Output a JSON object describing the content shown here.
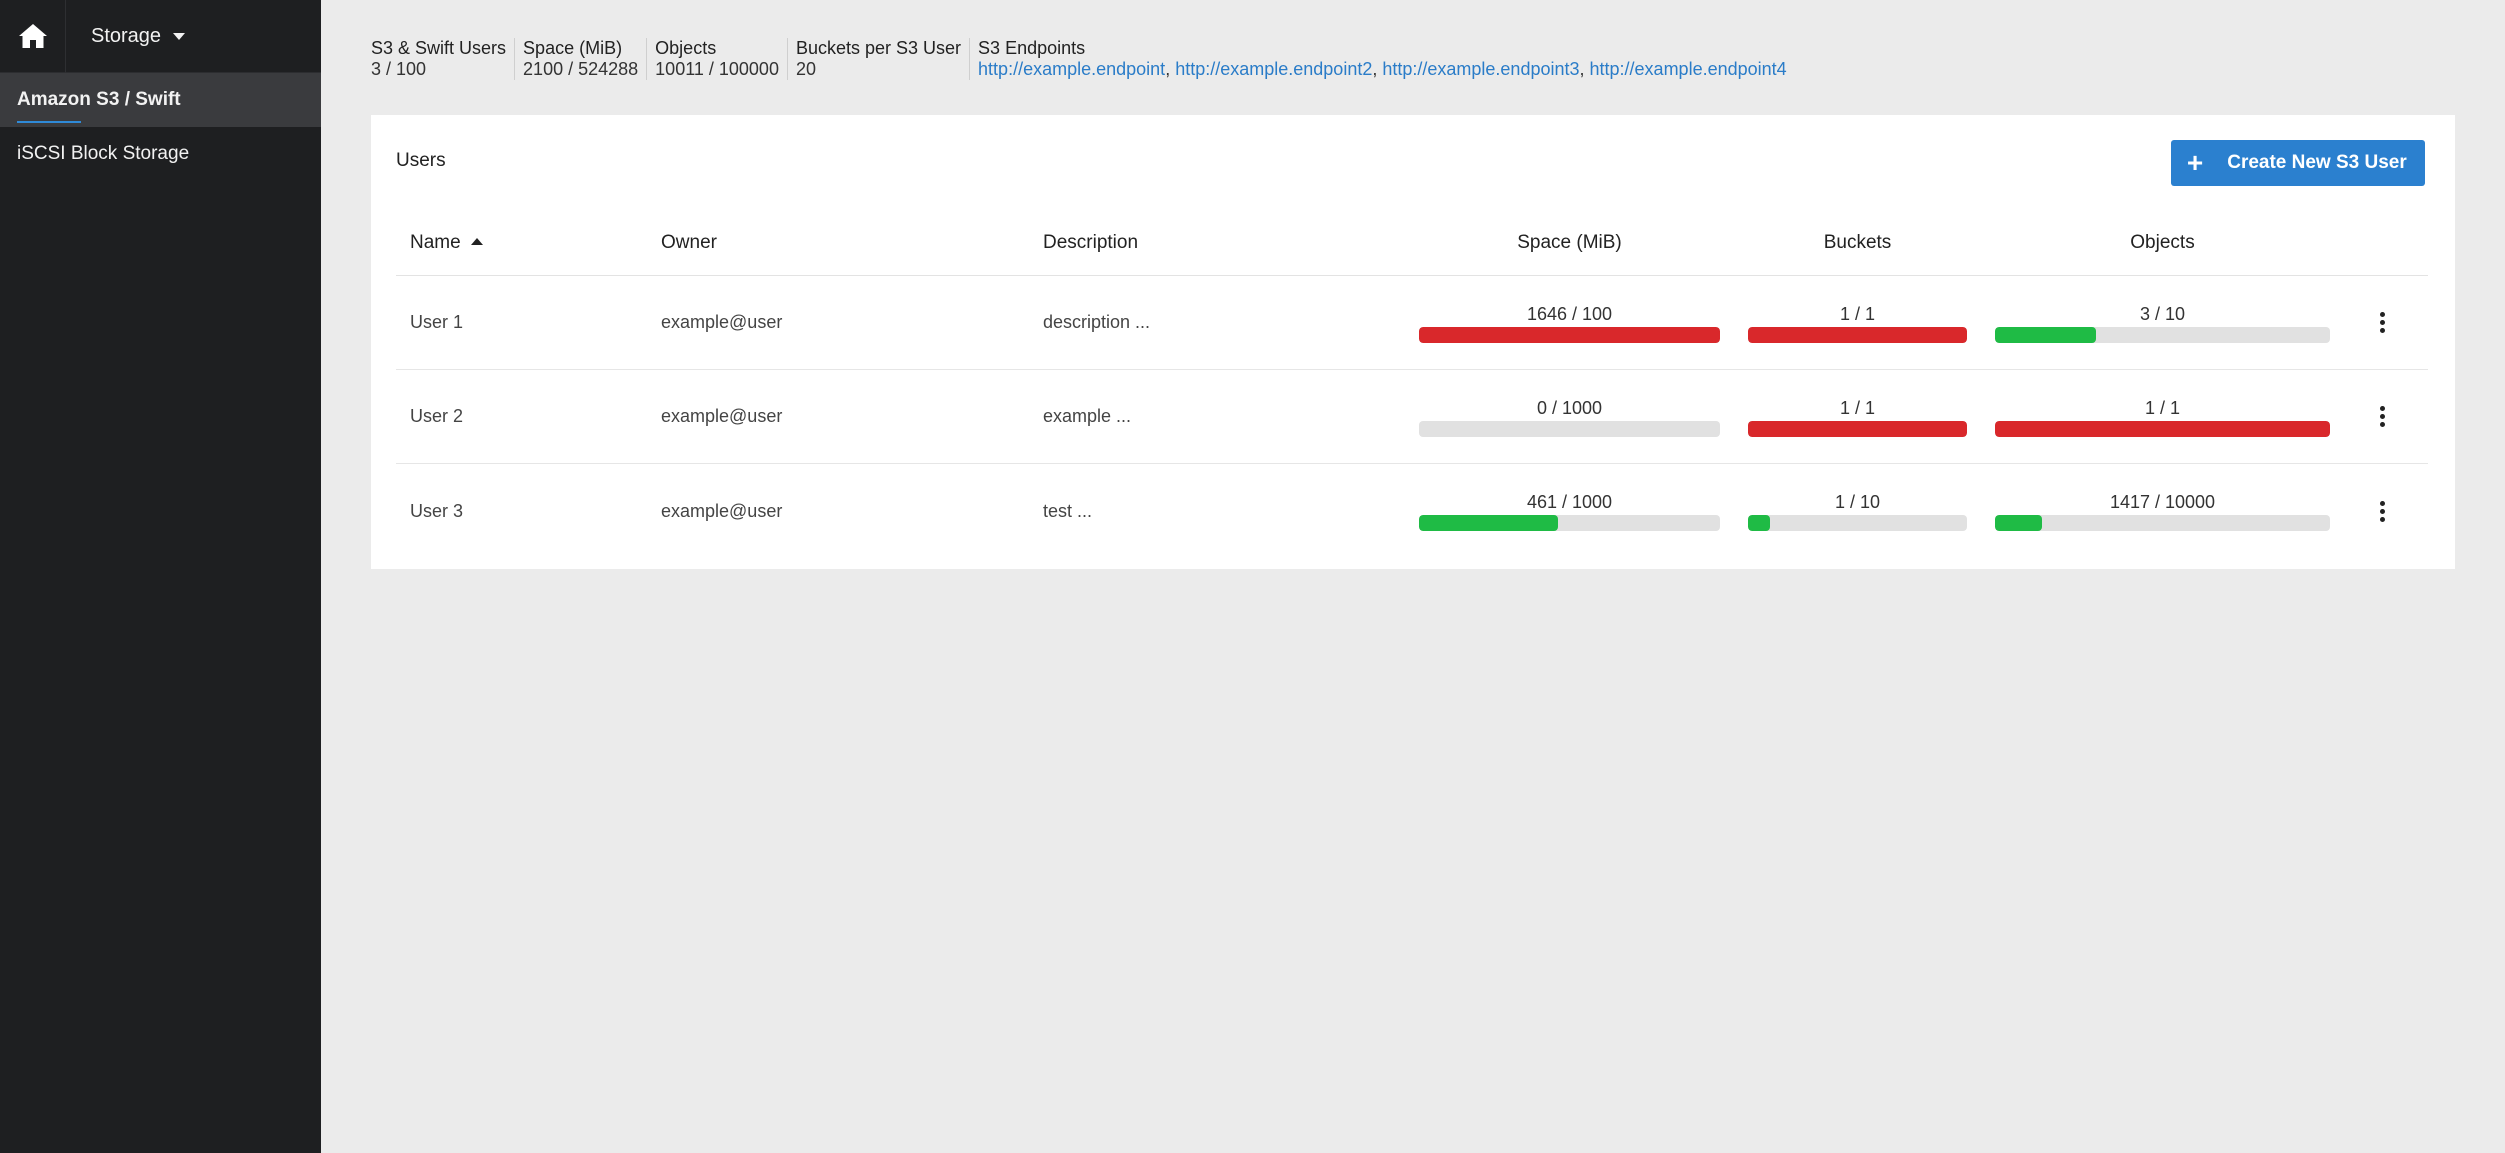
{
  "nav": {
    "home_icon": "home-icon",
    "storage_label": "Storage",
    "items": [
      {
        "label": "Amazon S3 / Swift",
        "active": true
      },
      {
        "label": "iSCSI Block Storage",
        "active": false
      }
    ]
  },
  "stats": [
    {
      "label": "S3 & Swift Users",
      "value": "3 / 100"
    },
    {
      "label": "Space (MiB)",
      "value": "2100 / 524288"
    },
    {
      "label": "Objects",
      "value": "10011 / 100000"
    },
    {
      "label": "Buckets per S3 User",
      "value": "20"
    }
  ],
  "endpoints": {
    "label": "S3 Endpoints",
    "links": [
      "http://example.endpoint",
      "http://example.endpoint2",
      "http://example.endpoint3",
      "http://example.endpoint4"
    ]
  },
  "card": {
    "title": "Users",
    "create_button": "Create New S3 User"
  },
  "table": {
    "headers": {
      "name": "Name",
      "owner": "Owner",
      "description": "Description",
      "space": "Space (MiB)",
      "buckets": "Buckets",
      "objects": "Objects"
    },
    "rows": [
      {
        "name": "User 1",
        "owner": "example@user",
        "description": "description ...",
        "space": {
          "label": "1646 / 100",
          "fraction": 1.0,
          "status": "red"
        },
        "buckets": {
          "label": "1 / 1",
          "fraction": 1.0,
          "status": "red"
        },
        "objects": {
          "label": "3 / 10",
          "fraction": 0.3,
          "status": "green"
        }
      },
      {
        "name": "User 2",
        "owner": "example@user",
        "description": "example ...",
        "space": {
          "label": "0 / 1000",
          "fraction": 0.0,
          "status": "green"
        },
        "buckets": {
          "label": "1 / 1",
          "fraction": 1.0,
          "status": "red"
        },
        "objects": {
          "label": "1 / 1",
          "fraction": 1.0,
          "status": "red"
        }
      },
      {
        "name": "User 3",
        "owner": "example@user",
        "description": "test ...",
        "space": {
          "label": "461 / 1000",
          "fraction": 0.461,
          "status": "green"
        },
        "buckets": {
          "label": "1 / 10",
          "fraction": 0.1,
          "status": "green"
        },
        "objects": {
          "label": "1417 / 10000",
          "fraction": 0.1417,
          "status": "green"
        }
      }
    ]
  },
  "colors": {
    "red": "#d9282b",
    "green": "#1fbb45",
    "accent": "#2b80cf",
    "sidebar": "#1e1f21"
  }
}
